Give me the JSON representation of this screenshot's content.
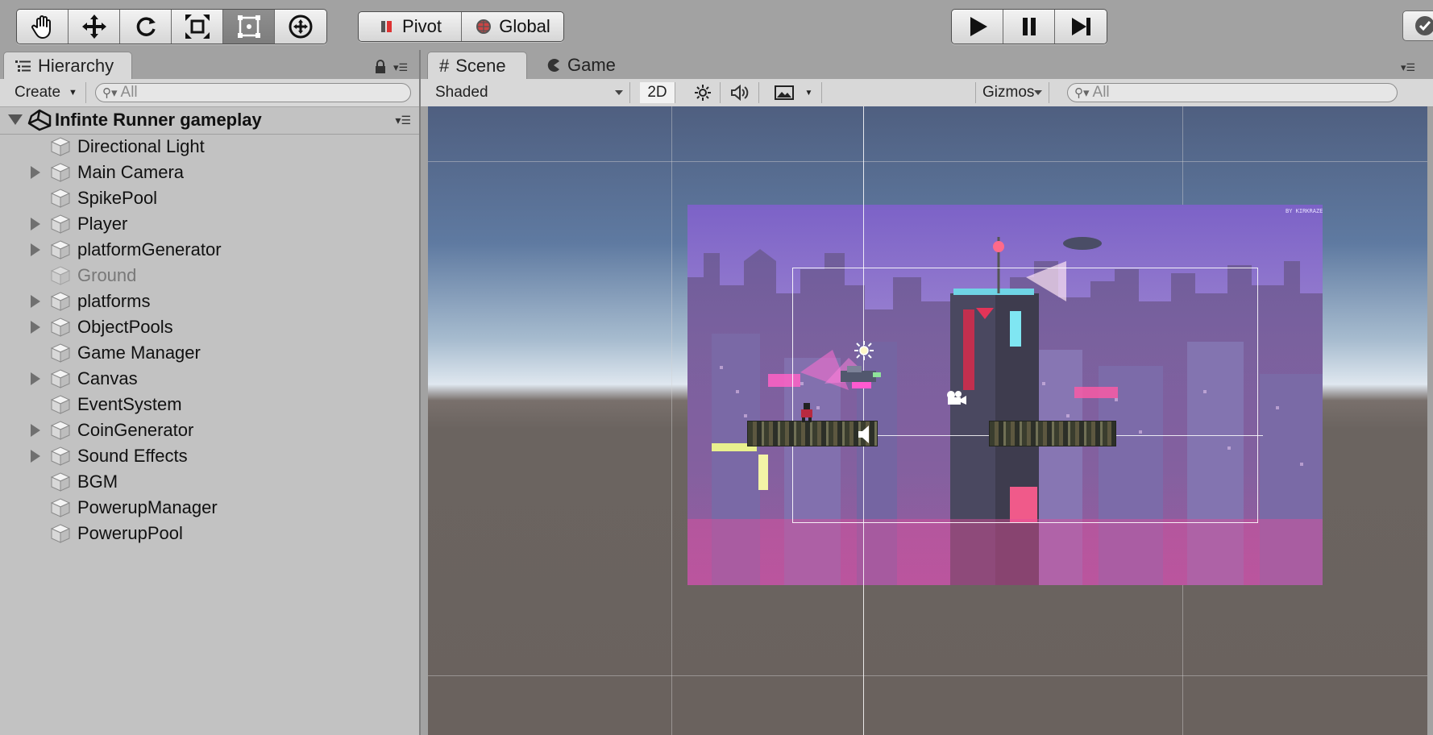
{
  "toolbar": {
    "tools": [
      {
        "name": "hand-tool",
        "icon": "hand-icon"
      },
      {
        "name": "move-tool",
        "icon": "move-arrows-icon"
      },
      {
        "name": "rotate-tool",
        "icon": "rotate-icon"
      },
      {
        "name": "scale-tool",
        "icon": "scale-icon"
      },
      {
        "name": "rect-tool",
        "icon": "rect-transform-icon",
        "active": true
      },
      {
        "name": "transform-tool",
        "icon": "transform-icon"
      }
    ],
    "pivot_label": "Pivot",
    "global_label": "Global",
    "play_icons": [
      "play-icon",
      "pause-icon",
      "step-icon"
    ]
  },
  "hierarchy": {
    "tab_label": "Hierarchy",
    "create_label": "Create",
    "search_placeholder": "All",
    "scene_name": "Infinte Runner gameplay",
    "items": [
      {
        "label": "Directional Light",
        "expandable": false,
        "active": true
      },
      {
        "label": "Main Camera",
        "expandable": true,
        "active": true
      },
      {
        "label": "SpikePool",
        "expandable": false,
        "active": true
      },
      {
        "label": "Player",
        "expandable": true,
        "active": true
      },
      {
        "label": "platformGenerator",
        "expandable": true,
        "active": true
      },
      {
        "label": "Ground",
        "expandable": false,
        "active": false
      },
      {
        "label": "platforms",
        "expandable": true,
        "active": true
      },
      {
        "label": "ObjectPools",
        "expandable": true,
        "active": true
      },
      {
        "label": "Game Manager",
        "expandable": false,
        "active": true
      },
      {
        "label": "Canvas",
        "expandable": true,
        "active": true
      },
      {
        "label": "EventSystem",
        "expandable": false,
        "active": true
      },
      {
        "label": "CoinGenerator",
        "expandable": true,
        "active": true
      },
      {
        "label": "Sound Effects",
        "expandable": true,
        "active": true
      },
      {
        "label": "BGM",
        "expandable": false,
        "active": true
      },
      {
        "label": "PowerupManager",
        "expandable": false,
        "active": true
      },
      {
        "label": "PowerupPool",
        "expandable": false,
        "active": true
      }
    ]
  },
  "scene": {
    "tab_scene": "Scene",
    "tab_game": "Game",
    "draw_mode": "Shaded",
    "mode_2d": "2D",
    "gizmos_label": "Gizmos",
    "search_placeholder": "All",
    "backdrop_credit": "BY KIRKRAZE"
  },
  "colors": {
    "panel_bg": "#c2c2c2",
    "toolbar_bg": "#a2a2a2",
    "sky_top": "#4f5f80",
    "city_purple": "#8a6fc0",
    "neon_pink": "#e34ba2"
  }
}
